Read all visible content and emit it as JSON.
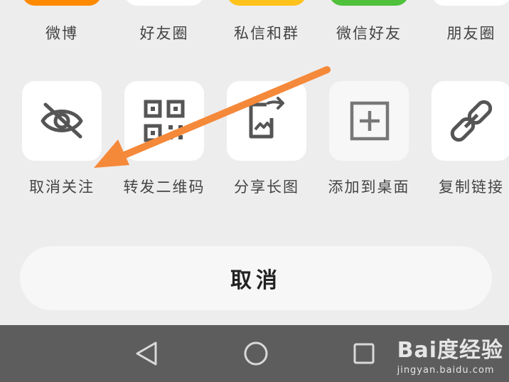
{
  "share_targets": [
    {
      "label": "微博",
      "icon": "weibo-icon",
      "color": "#ff8a00"
    },
    {
      "label": "好友圈",
      "icon": "friend-circle-icon",
      "color": "#ffffff"
    },
    {
      "label": "私信和群",
      "icon": "message-icon",
      "color": "#ffc21a"
    },
    {
      "label": "微信好友",
      "icon": "wechat-icon",
      "color": "#4fc13a"
    },
    {
      "label": "朋友圈",
      "icon": "moments-icon",
      "color": "#ffffff"
    }
  ],
  "actions": [
    {
      "label": "取消关注",
      "icon": "eye-slash-icon"
    },
    {
      "label": "转发二维码",
      "icon": "qr-code-icon"
    },
    {
      "label": "分享长图",
      "icon": "share-image-icon"
    },
    {
      "label": "添加到桌面",
      "icon": "add-to-desktop-icon"
    },
    {
      "label": "复制链接",
      "icon": "link-icon"
    }
  ],
  "cancel": {
    "label": "取消"
  },
  "nav": {
    "back": "back-icon",
    "home": "home-icon",
    "recent": "recent-apps-icon"
  },
  "watermark": {
    "logo": "Bai度经验",
    "url": "jingyan.baidu.com"
  },
  "colors": {
    "background": "#ededed",
    "tile": "#ffffff",
    "annotation_arrow": "#f5893a",
    "navbar": "#5d5d5d"
  }
}
